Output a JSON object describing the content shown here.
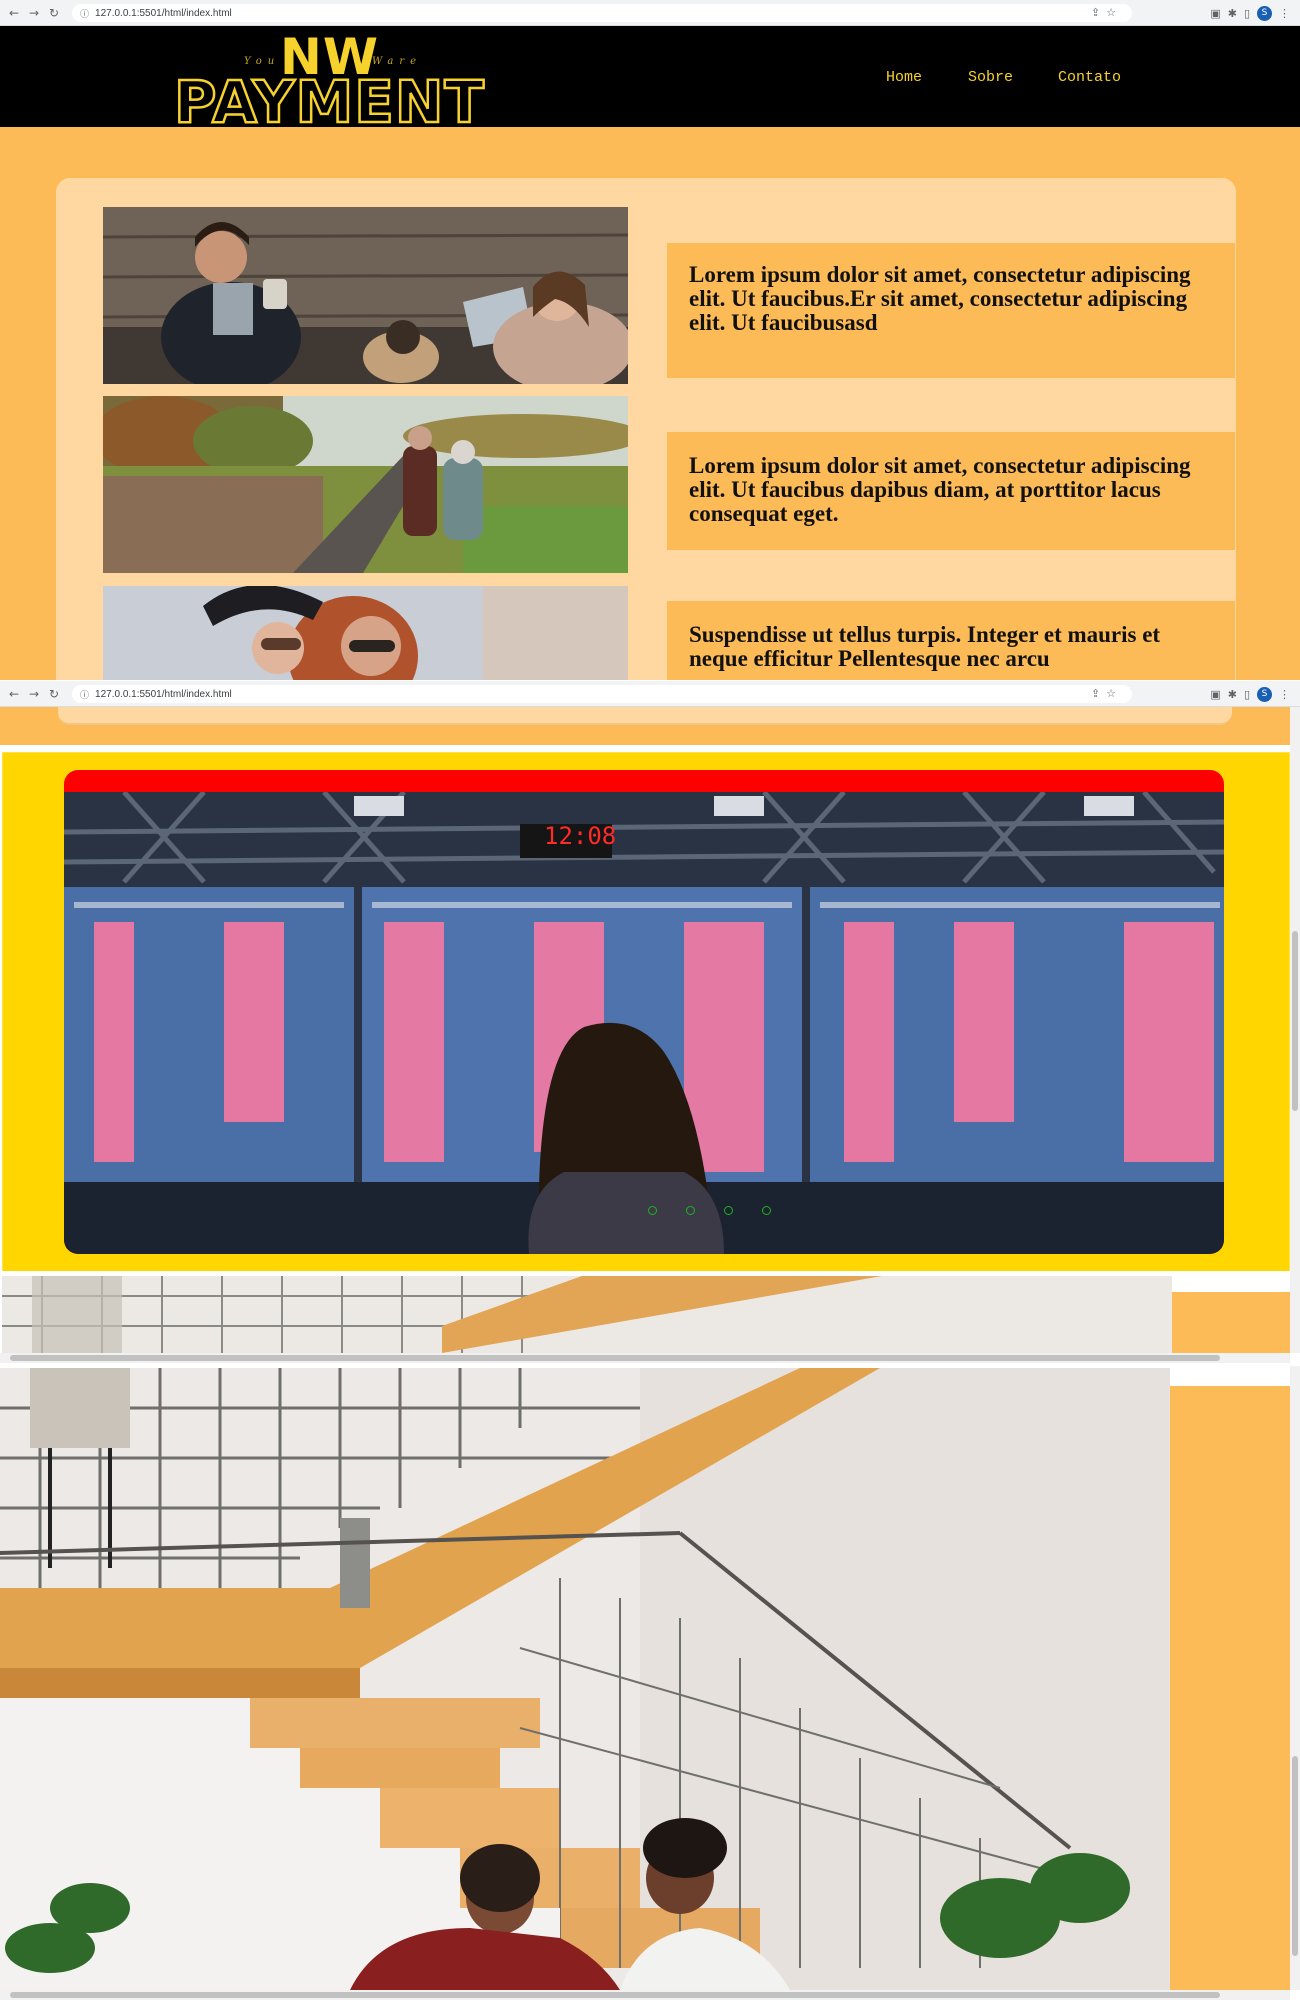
{
  "browser": {
    "url": "127.0.0.1:5501/html/index.html",
    "url_second": "127.0.0.1:5501/html/index.html",
    "avatar_initial": "S"
  },
  "header": {
    "logo_top": "NW",
    "logo_script_left": "You",
    "logo_script_right": "Ware",
    "logo_main": "PAYMENT",
    "nav": [
      "Home",
      "Sobre",
      "Contato"
    ]
  },
  "content": {
    "boxes": [
      "Lorem ipsum dolor sit amet, consectetur adipiscing elit. Ut faucibus.Er sit amet, consectetur adipiscing elit. Ut faucibusasd",
      "Lorem ipsum dolor sit amet, consectetur adipiscing elit. Ut faucibus dapibus diam, at porttitor lacus consequat eget.",
      "Suspendisse ut tellus turpis. Integer et mauris et neque efficitur Pellentesque nec arcu"
    ],
    "photos": [
      "couple-with-dog-photo",
      "elderly-couple-walking-photo",
      "two-women-sunglasses-photo"
    ]
  },
  "slider": {
    "clock_text": "12:08",
    "dots": 4
  },
  "colors": {
    "header_bg": "#000000",
    "brand_yellow": "#f7d22c",
    "orange": "#fdbb57",
    "card_peach": "#fed8a0",
    "slider_yellow": "#ffd600",
    "slider_red": "#ff0000",
    "dot_green": "#1db31d"
  }
}
